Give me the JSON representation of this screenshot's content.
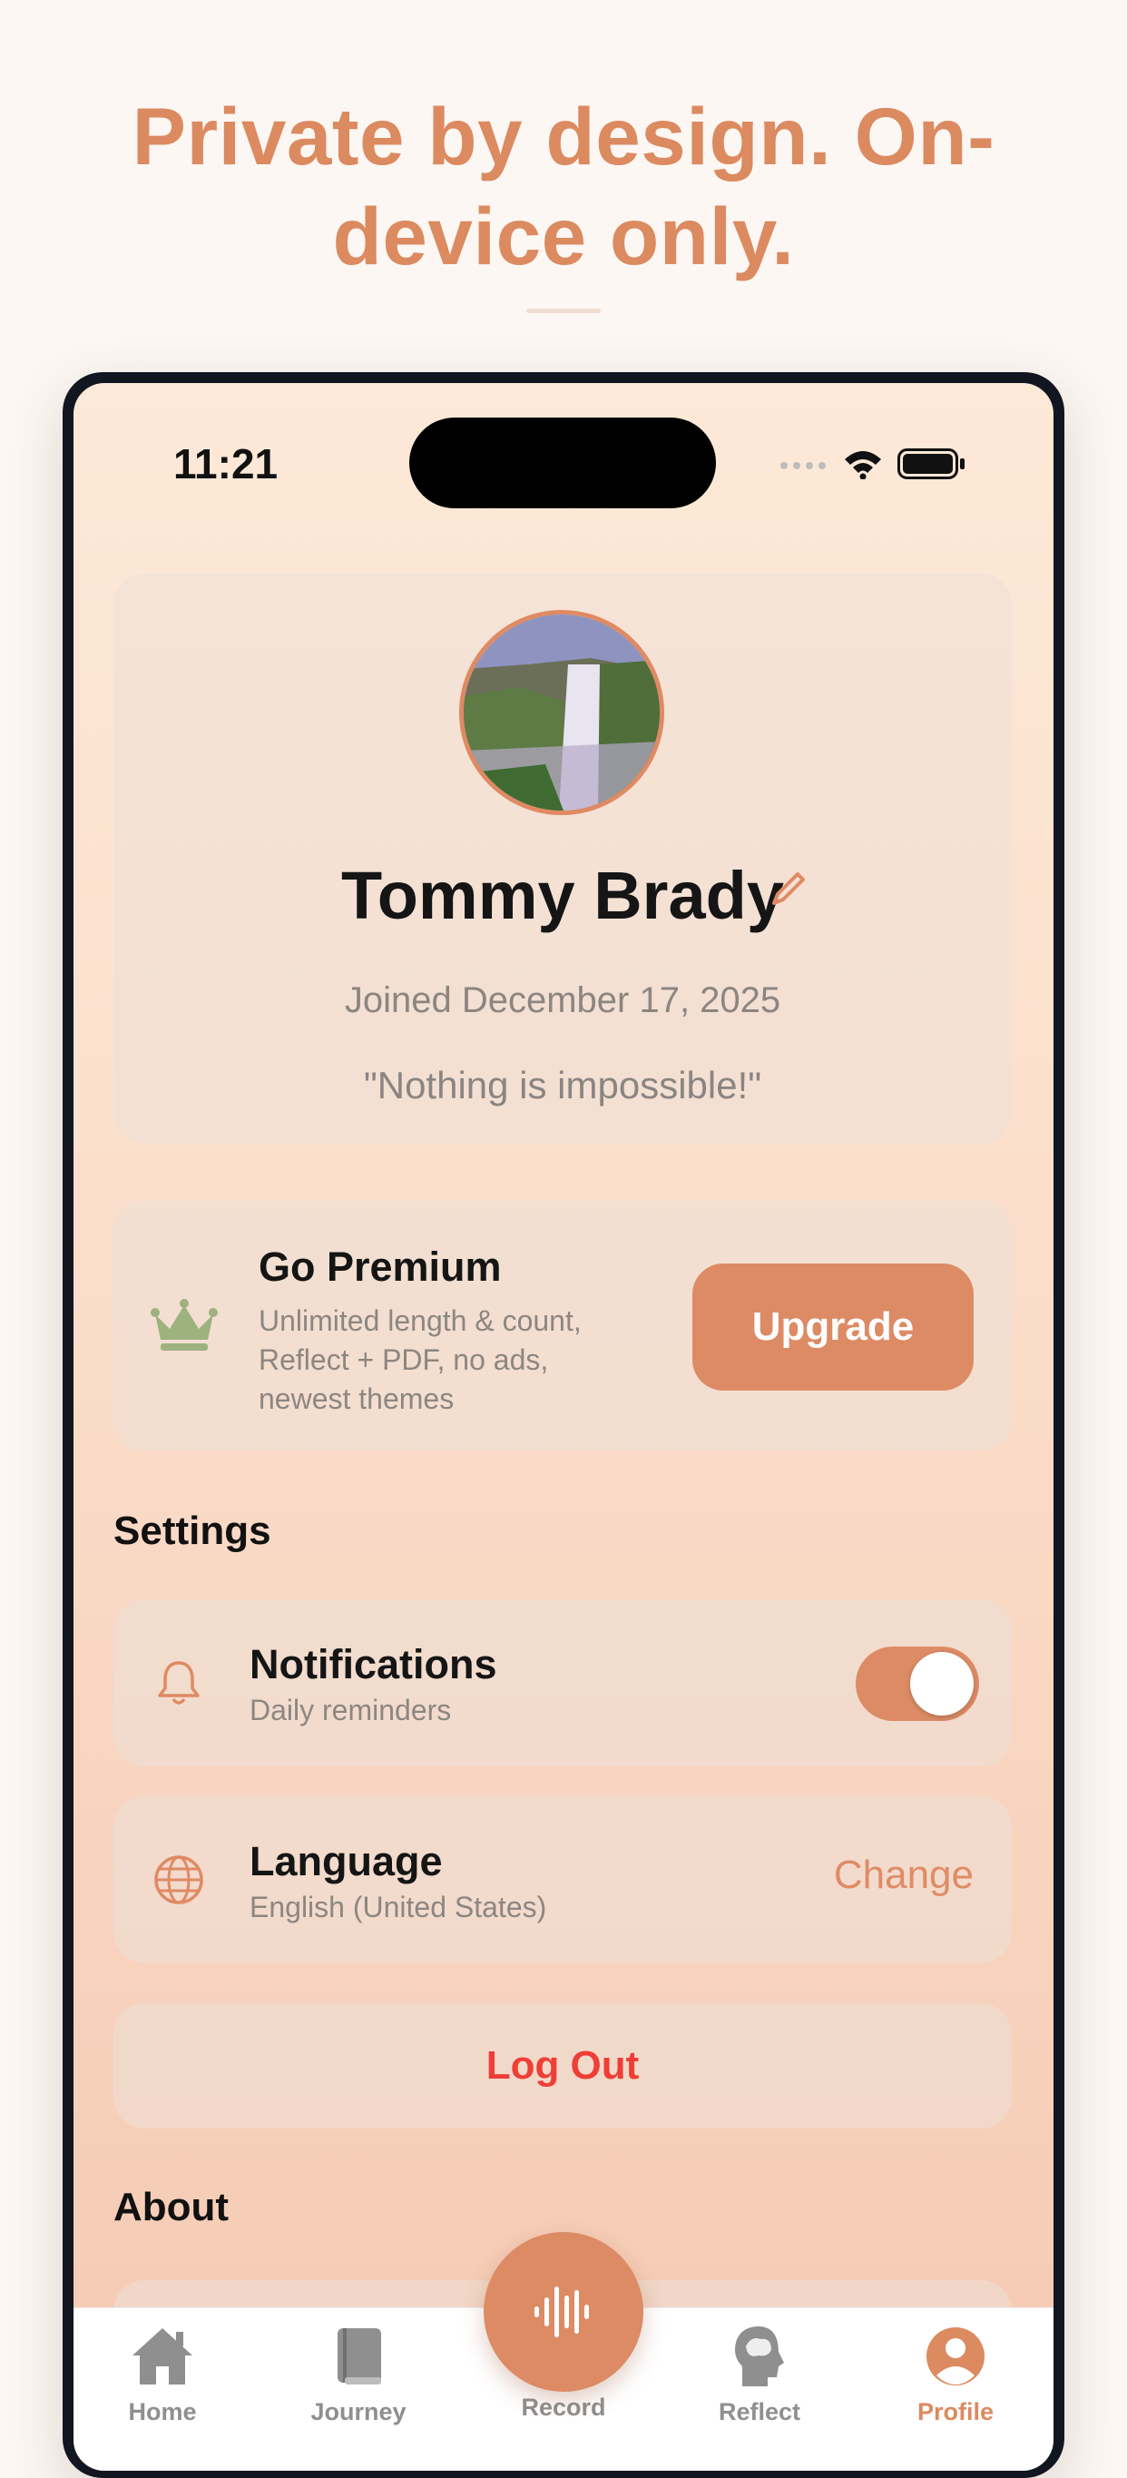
{
  "headline": {
    "line1": "Private by design. On-",
    "line2": "device only."
  },
  "status_bar": {
    "time": "11:21",
    "icons": [
      "signal-icon",
      "wifi-icon",
      "battery-icon"
    ]
  },
  "profile": {
    "name": "Tommy Brady",
    "joined": "Joined December 17, 2025",
    "quote": "\"Nothing is impossible!\"",
    "avatar": "waterfall-photo"
  },
  "premium": {
    "title": "Go Premium",
    "description": "Unlimited length & count, Reflect + PDF, no ads, newest themes",
    "button": "Upgrade",
    "icon": "crown-icon"
  },
  "settings": {
    "title": "Settings",
    "notifications": {
      "title": "Notifications",
      "subtitle": "Daily reminders",
      "enabled": true,
      "icon": "bell-icon"
    },
    "language": {
      "title": "Language",
      "subtitle": "English (United States)",
      "action": "Change",
      "icon": "globe-icon"
    },
    "logout": "Log Out"
  },
  "about": {
    "title": "About"
  },
  "tabs": [
    {
      "label": "Home",
      "icon": "home-icon"
    },
    {
      "label": "Journey",
      "icon": "book-icon"
    },
    {
      "label": "Record",
      "icon": "waveform-icon"
    },
    {
      "label": "Reflect",
      "icon": "brain-head-icon"
    },
    {
      "label": "Profile",
      "icon": "profile-icon",
      "active": true
    }
  ],
  "colors": {
    "accent": "#dc8b65",
    "logout": "#ee3e36",
    "crown": "#9db27e"
  }
}
